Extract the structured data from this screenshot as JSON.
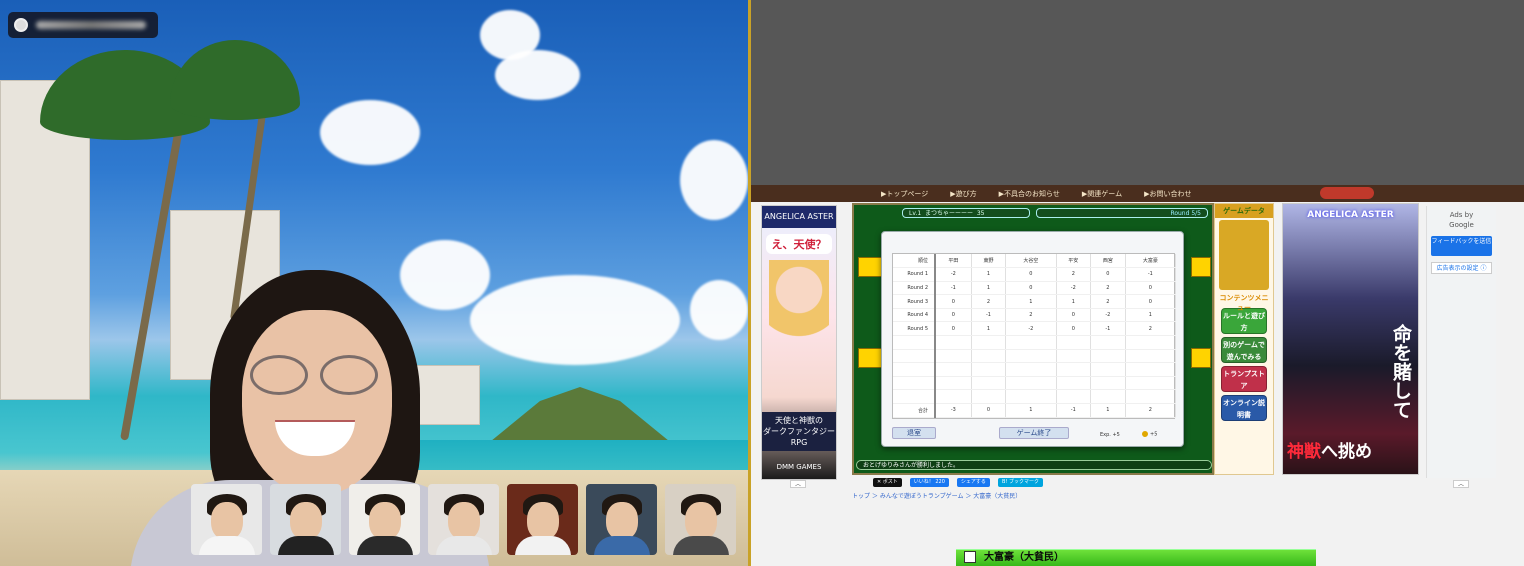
{
  "video_call": {
    "participant_count_thumbs": 7
  },
  "site": {
    "nav": [
      "▶トップページ",
      "▶遊び方",
      "▶不具合のお知らせ",
      "▶関連ゲーム",
      "▶お問い合わせ"
    ]
  },
  "game": {
    "player_label": "Lv.1",
    "player_name": "まつちゃーーーー",
    "coins": "35",
    "round": "Round 5/5",
    "status_text": "おとげゆりみさんが勝利しました。"
  },
  "scoreboard": {
    "headers": [
      "順位",
      "平田",
      "東野",
      "大谷空",
      "平安",
      "西宮",
      "大富豪"
    ],
    "rows": [
      {
        "name": "Round 1",
        "values": [
          "-2",
          "1",
          "0",
          "2",
          "0",
          "-1"
        ]
      },
      {
        "name": "Round 2",
        "values": [
          "-1",
          "1",
          "0",
          "-2",
          "2",
          "0"
        ]
      },
      {
        "name": "Round 3",
        "values": [
          "0",
          "2",
          "1",
          "1",
          "2",
          "0"
        ]
      },
      {
        "name": "Round 4",
        "values": [
          "0",
          "-1",
          "2",
          "0",
          "-2",
          "1"
        ]
      },
      {
        "name": "Round 5",
        "values": [
          "0",
          "1",
          "-2",
          "0",
          "-1",
          "2"
        ]
      }
    ],
    "total_label": "合計",
    "totals": [
      "-3",
      "0",
      "1",
      "-1",
      "1",
      "2"
    ],
    "exit_label": "退室",
    "end_label": "ゲーム終了",
    "exp_text": "Exp. +5",
    "coin_text": "+5"
  },
  "left_ad": {
    "head": "ANGELICA ASTER",
    "catch": "え、天使？",
    "text_line1": "天使と神獣の",
    "text_line2": "ダークファンタジー",
    "text_line3": "RPG",
    "brand": "DMM GAMES"
  },
  "menu": {
    "title": "ゲームデータ",
    "head": "コンテンツメニュー",
    "buttons": [
      {
        "label": "ルールと遊び方",
        "color": "#3aa63a"
      },
      {
        "label": "別のゲームで遊んでみる",
        "color": "#3a8a3a"
      },
      {
        "label": "トランプストア",
        "color": "#c0304a"
      },
      {
        "label": "オンライン説明書",
        "color": "#2a5aa8"
      }
    ]
  },
  "right_ad": {
    "head": "ANGELICA ASTER",
    "big_text": "命を賭して",
    "bottom_pre": "",
    "bottom_red": "神獣",
    "bottom_post": "へ挑め"
  },
  "google_ad": {
    "ads_by": "Ads by",
    "google": "Google",
    "feedback": "フィードバックを送信",
    "why": "広告表示の設定 ⓘ"
  },
  "share": {
    "post": "✕ ポスト",
    "like": "いいね！ 220",
    "share": "シェアする",
    "bookmark": "B! ブックマーク"
  },
  "breadcrumb": "トップ  ＞  みんなで遊ぼうトランプゲーム  ＞  大富豪（大貧民）",
  "bottom_banner": "大富豪（大貧民）",
  "colors": {
    "gold_divider": "#c9a227",
    "game_green": "#0e5a1a",
    "site_brown": "#4a2e1e"
  }
}
